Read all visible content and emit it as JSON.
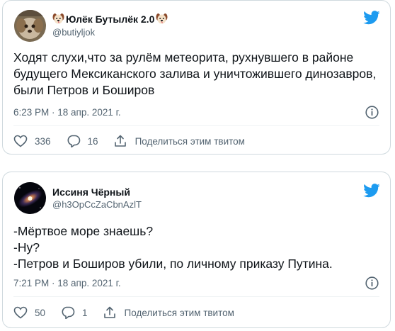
{
  "tweets": [
    {
      "author": {
        "name": "Юлёк Бутылёк 2.0",
        "handle": "@butiyljok",
        "name_emoji": "dog-face"
      },
      "text": "Ходят слухи,что за рулём метеорита, рухнувшего в районе будущего Мексиканского залива и уничтожившего динозавров, были Петров и Боширов",
      "timestamp": "6:23 PM · 18 апр. 2021 г.",
      "likes": "336",
      "replies": "16",
      "share_label": "Поделиться этим твитом"
    },
    {
      "author": {
        "name": "Иссиня Чёрный",
        "handle": "@h3OpCcZaCbnAzlT"
      },
      "text": "-Мёртвое море знаешь?\n-Ну?\n-Петров и Боширов убили, по личному приказу Путина.",
      "timestamp": "7:21 PM · 18 апр. 2021 г.",
      "likes": "50",
      "replies": "1",
      "share_label": "Поделиться этим твитом"
    }
  ],
  "colors": {
    "twitter_blue": "#1d9bf0",
    "secondary_text": "#536471",
    "border": "#cfd9de"
  },
  "icons": [
    "twitter-bird-icon",
    "info-icon",
    "heart-icon",
    "reply-bubble-icon",
    "share-icon"
  ]
}
